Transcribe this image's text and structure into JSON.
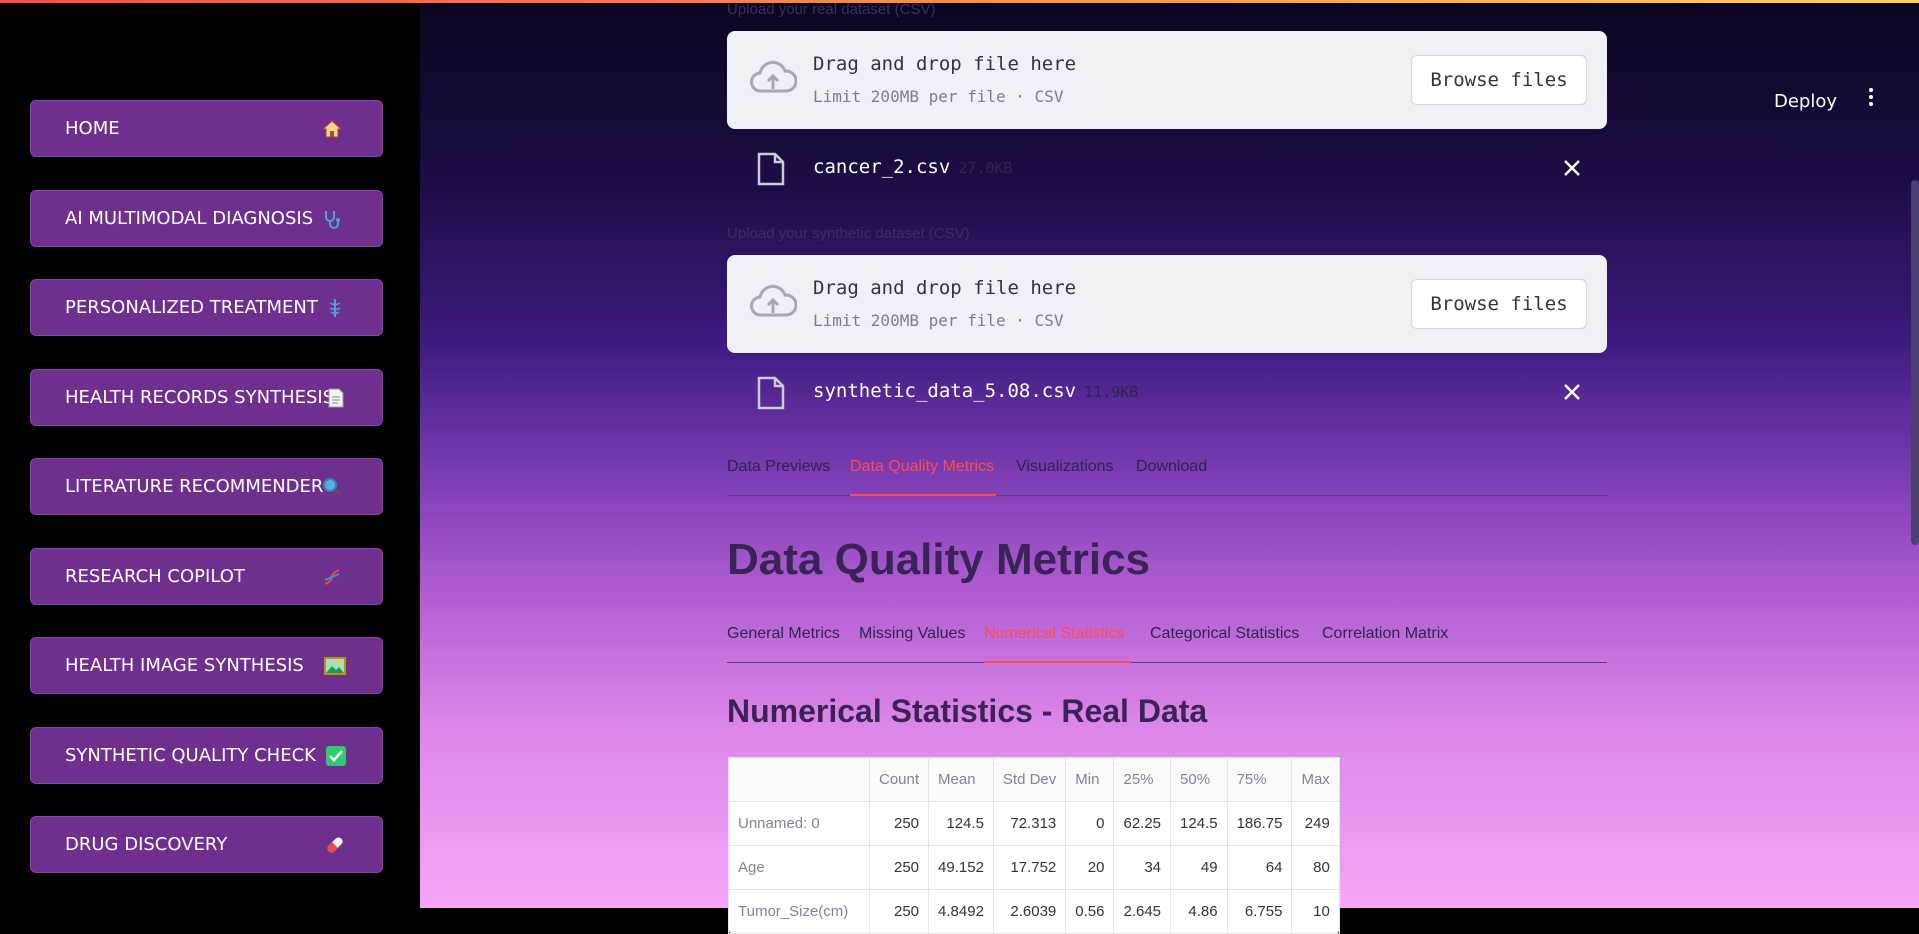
{
  "sidebar": {
    "items": [
      {
        "label": "HOME",
        "icon": "house-icon"
      },
      {
        "label": "AI MULTIMODAL DIAGNOSIS",
        "icon": "stethoscope-icon"
      },
      {
        "label": "PERSONALIZED TREATMENT",
        "icon": "caduceus-icon"
      },
      {
        "label": "HEALTH RECORDS SYNTHESIS",
        "icon": "document-icon"
      },
      {
        "label": "LITERATURE RECOMMENDER",
        "icon": "magnifier-icon"
      },
      {
        "label": "RESEARCH COPILOT",
        "icon": "dna-icon"
      },
      {
        "label": "HEALTH IMAGE SYNTHESIS",
        "icon": "picture-icon"
      },
      {
        "label": "SYNTHETIC QUALITY CHECK",
        "icon": "check-box-icon"
      },
      {
        "label": "DRUG DISCOVERY",
        "icon": "pill-icon"
      }
    ]
  },
  "header": {
    "deploy_label": "Deploy"
  },
  "uploads": [
    {
      "label": "Upload your real dataset (CSV)",
      "drag_text": "Drag and drop file here",
      "limit_text": "Limit 200MB per file · CSV",
      "browse_label": "Browse files",
      "file_name": "cancer_2.csv",
      "file_size": "27.0KB"
    },
    {
      "label": "Upload your synthetic dataset (CSV)",
      "drag_text": "Drag and drop file here",
      "limit_text": "Limit 200MB per file · CSV",
      "browse_label": "Browse files",
      "file_name": "synthetic_data_5.08.csv",
      "file_size": "11.9KB"
    }
  ],
  "main_tabs": [
    "Data Previews",
    "Data Quality Metrics",
    "Visualizations",
    "Download"
  ],
  "main_tab_active": "Data Quality Metrics",
  "page_title": "Data Quality Metrics",
  "sub_tabs": [
    "General Metrics",
    "Missing Values",
    "Numerical Statistics",
    "Categorical Statistics",
    "Correlation Matrix"
  ],
  "sub_tab_active": "Numerical Statistics",
  "section_title": "Numerical Statistics - Real Data",
  "table": {
    "headers": [
      "",
      "Count",
      "Mean",
      "Std Dev",
      "Min",
      "25%",
      "50%",
      "75%",
      "Max"
    ],
    "rows": [
      [
        "Unnamed: 0",
        "250",
        "124.5",
        "72.313",
        "0",
        "62.25",
        "124.5",
        "186.75",
        "249"
      ],
      [
        "Age",
        "250",
        "49.152",
        "17.752",
        "20",
        "34",
        "49",
        "64",
        "80"
      ],
      [
        "Tumor_Size(cm)",
        "250",
        "4.8492",
        "2.6039",
        "0.56",
        "2.645",
        "4.86",
        "6.755",
        "10"
      ]
    ]
  },
  "colors": {
    "accent": "#ff4b4b",
    "nav_bg": "#6e2f8f"
  }
}
